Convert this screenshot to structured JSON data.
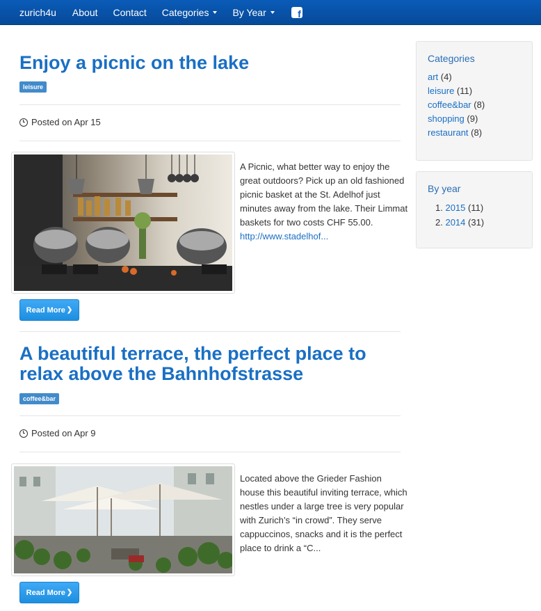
{
  "navbar": {
    "brand": "zurich4u",
    "items": [
      {
        "label": "About"
      },
      {
        "label": "Contact"
      },
      {
        "label": "Categories"
      },
      {
        "label": "By Year"
      }
    ],
    "facebook_icon": "facebook-icon"
  },
  "posts": [
    {
      "title": "Enjoy a picnic on the lake",
      "category": "leisure",
      "posted": "Posted on Apr 15",
      "excerpt": "A Picnic, what better way to enjoy the great outdoors? Pick up an old fashioned picnic basket at the St. Adelhof just minutes away from the lake. Their Limmat baskets for two costs CHF 55.00.",
      "link": "http://www.stadelhof...",
      "read_more": "Read More"
    },
    {
      "title": "A beautiful terrace, the perfect place to relax above the Bahnhofstrasse",
      "category": "coffee&bar",
      "posted": "Posted on Apr 9",
      "excerpt": "Located above the Grieder Fashion house this beautiful inviting terrace, which nestles under a large tree is very popular with Zurich’s  “in crowd”. They serve cappuccinos, snacks and it is the perfect place to drink a “C...",
      "read_more": "Read More"
    }
  ],
  "sidebar": {
    "categories_title": "Categories",
    "categories": [
      {
        "name": "art",
        "count": "(4)"
      },
      {
        "name": "leisure",
        "count": "(11)"
      },
      {
        "name": "coffee&bar",
        "count": "(8)"
      },
      {
        "name": "shopping",
        "count": "(9)"
      },
      {
        "name": "restaurant",
        "count": "(8)"
      }
    ],
    "year_title": "By year",
    "years": [
      {
        "num": "1.",
        "year": "2015",
        "count": "(11)"
      },
      {
        "num": "2.",
        "year": "2014",
        "count": "(31)"
      }
    ]
  },
  "colors": {
    "navbar": "#0a5bb8",
    "title": "#1a6fc4",
    "badge": "#428bca",
    "button": "#2b9aea"
  }
}
